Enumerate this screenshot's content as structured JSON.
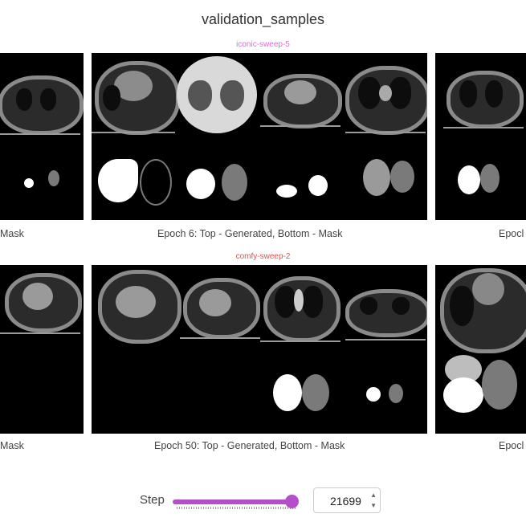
{
  "panel": {
    "title": "validation_samples"
  },
  "runs": [
    {
      "name": "iconic-sweep-5",
      "name_color": "#e26ad6",
      "left_caption": "Mask",
      "center_caption": "Epoch 6: Top - Generated, Bottom - Mask",
      "right_caption": "Epocl"
    },
    {
      "name": "comfy-sweep-2",
      "name_color": "#e05050",
      "left_caption": "Mask",
      "center_caption": "Epoch 50: Top - Generated, Bottom - Mask",
      "right_caption": "Epocl"
    }
  ],
  "step": {
    "label": "Step",
    "value": "21699",
    "slider_fraction": 0.95,
    "accent": "#b54ec9"
  }
}
